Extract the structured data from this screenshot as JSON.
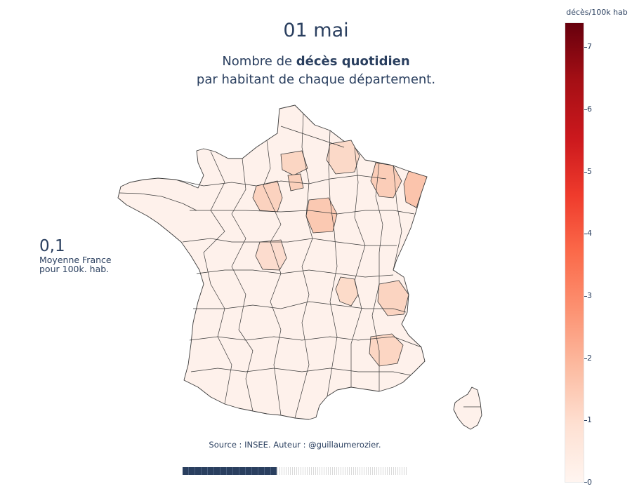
{
  "title": "01 mai",
  "subtitle": {
    "prefix": "Nombre de ",
    "bold": "décès quotidien",
    "line2": "par habitant de chaque département."
  },
  "average": {
    "value": "0,1",
    "label_line1": "Moyenne France",
    "label_line2": "pour 100k. hab."
  },
  "source": "Source : INSEE. Auteur : @guillaumerozier.",
  "colorbar": {
    "title": "décès/100k hab",
    "min": 0,
    "max": 7.4,
    "ticks": [
      "0",
      "1",
      "2",
      "3",
      "4",
      "5",
      "6",
      "7"
    ],
    "colorscale": [
      "#fff5f0",
      "#fee0d2",
      "#fcbba1",
      "#fc9272",
      "#fb6a4a",
      "#ef3b2c",
      "#cb181d",
      "#a50f15",
      "#67000d"
    ]
  },
  "timeline": {
    "progress": 0.42
  },
  "colors": {
    "text": "#2a3f5f",
    "border": "#333333"
  }
}
